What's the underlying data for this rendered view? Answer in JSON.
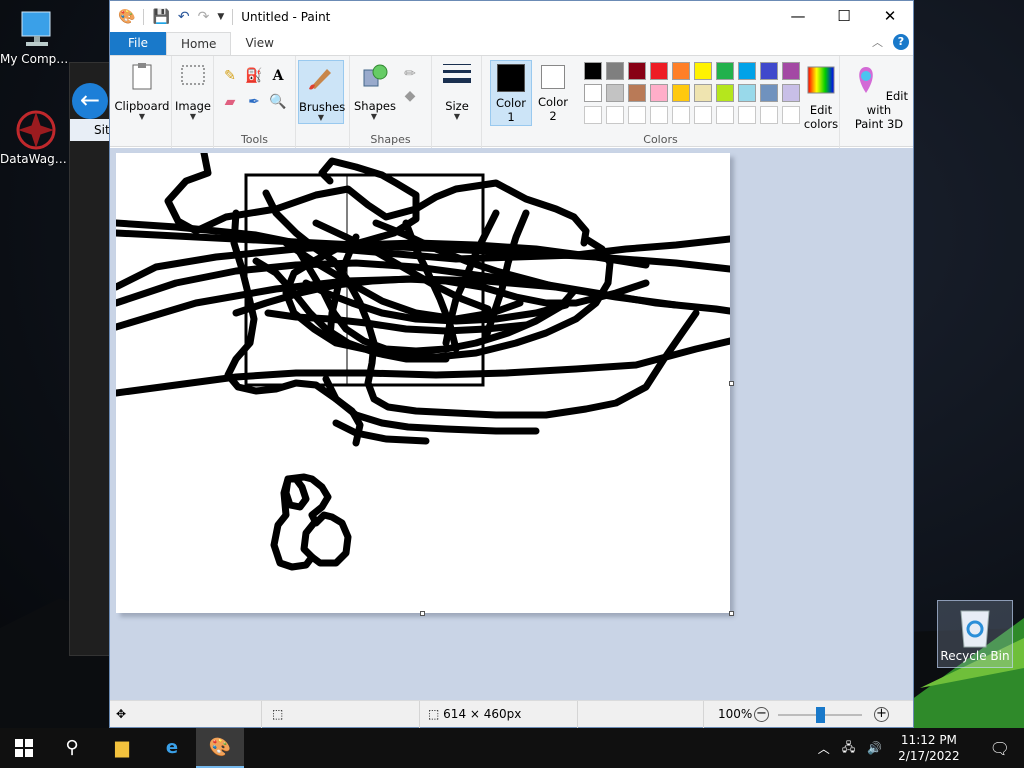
{
  "desktop": {
    "icons": [
      {
        "label": "My Computer"
      },
      {
        "label": "DataWagon..."
      }
    ],
    "recycle_bin": {
      "label": "Recycle Bin"
    },
    "ie_window": {
      "tab_text": "Sit"
    }
  },
  "paint": {
    "title": "Untitled - Paint",
    "tabs": [
      {
        "label": "File"
      },
      {
        "label": "Home"
      },
      {
        "label": "View"
      }
    ],
    "help_icon": "?",
    "ribbon": {
      "clipboard": {
        "label": "Clipboard"
      },
      "image": {
        "label": "Image"
      },
      "tools_group": "Tools",
      "brushes": {
        "label": "Brushes"
      },
      "shapes": {
        "label": "Shapes"
      },
      "shapes_group": "Shapes",
      "size": {
        "label": "Size"
      },
      "color1": {
        "label": "Color",
        "num": "1"
      },
      "color2": {
        "label": "Color",
        "num": "2"
      },
      "colors_group": "Colors",
      "edit_colors": {
        "line1": "Edit",
        "line2": "colors"
      },
      "edit_paint3d": {
        "line1": "Edit with",
        "line2": "Paint 3D"
      }
    },
    "palette_row1": [
      "#000000",
      "#7f7f7f",
      "#880015",
      "#ed1c24",
      "#ff7f27",
      "#fff200",
      "#22b14c",
      "#00a2e8",
      "#3f48cc",
      "#a349a4"
    ],
    "palette_row2": [
      "#ffffff",
      "#c3c3c3",
      "#b97a57",
      "#ffaec9",
      "#ffc90e",
      "#efe4b0",
      "#b5e61d",
      "#99d9ea",
      "#7092be",
      "#c8bfe7"
    ],
    "color1_value": "#000000",
    "color2_value": "#ffffff",
    "status": {
      "dimensions": "614 × 460px",
      "zoom": "100%",
      "zoom_fraction": 0.5
    }
  },
  "taskbar": {
    "time": "11:12 PM",
    "date": "2/17/2022"
  }
}
